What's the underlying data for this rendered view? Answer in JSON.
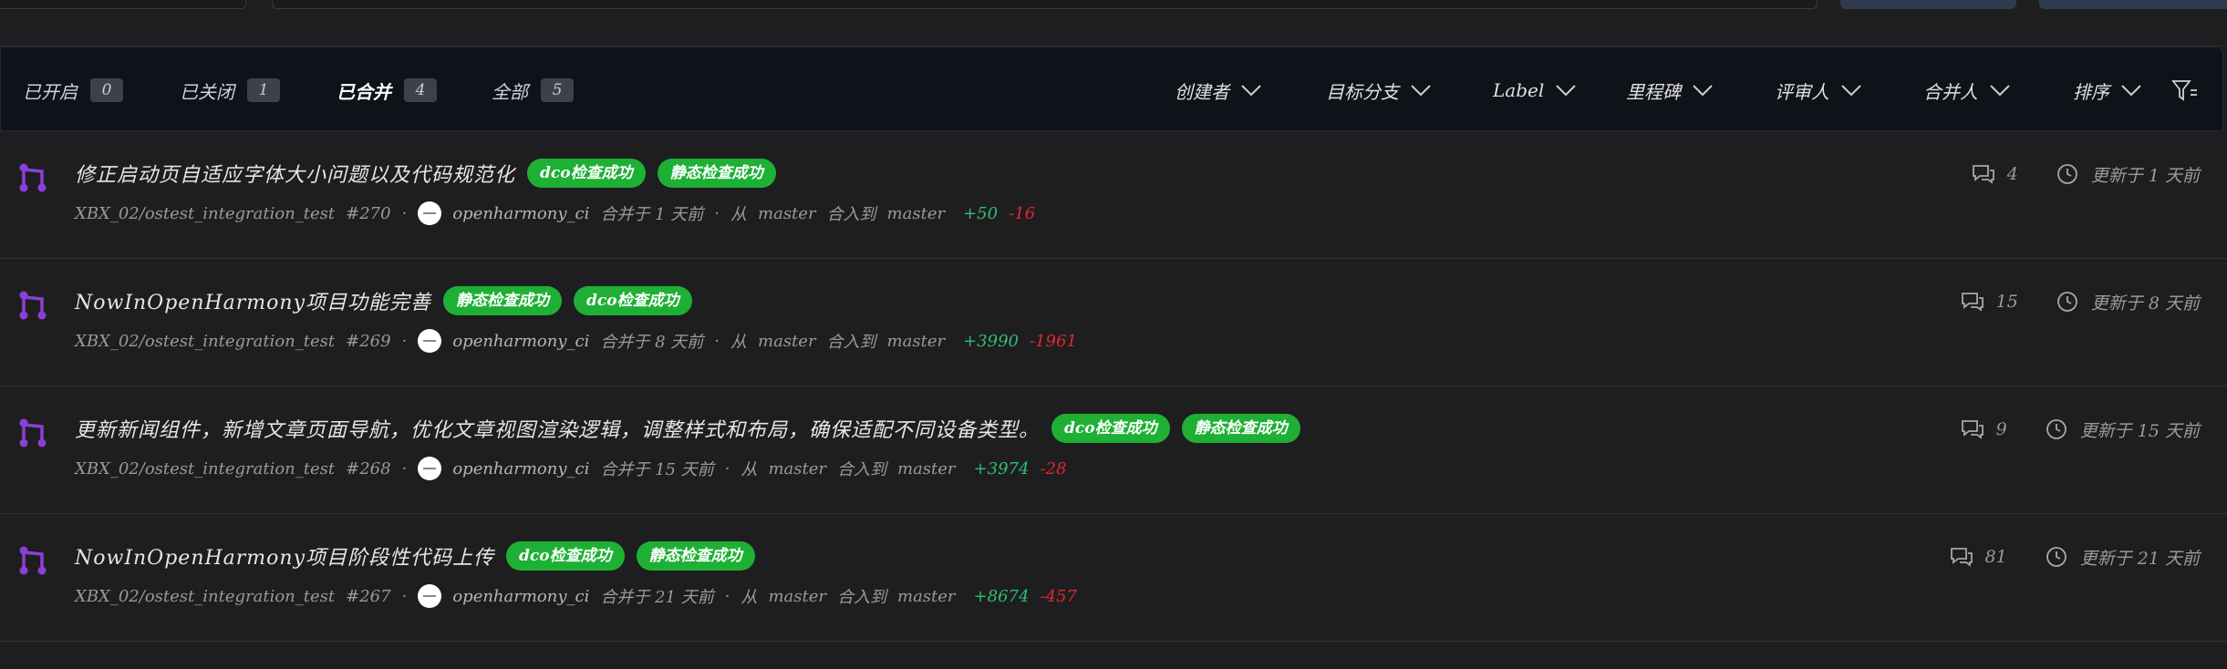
{
  "state_tabs": [
    {
      "label": "已开启",
      "count": "0"
    },
    {
      "label": "已关闭",
      "count": "1"
    },
    {
      "label": "已合并",
      "count": "4"
    },
    {
      "label": "全部",
      "count": "5"
    }
  ],
  "filters": [
    "创建者",
    "目标分支",
    "Label",
    "里程碑",
    "评审人",
    "合并人",
    "排序"
  ],
  "prs": [
    {
      "title": "修正启动页自适应字体大小问题以及代码规范化",
      "badges": [
        "dco检查成功",
        "静态检查成功"
      ],
      "repo": "XBX_02/ostest_integration_test",
      "number": "#270",
      "user": "openharmony_ci",
      "merged": "合并于 1 天前",
      "from_label": "从",
      "from": "master",
      "into_label": "合入到",
      "into": "master",
      "additions": "+50",
      "deletions": "-16",
      "comments": "4",
      "updated": "更新于 1 天前"
    },
    {
      "title": "NowInOpenHarmony项目功能完善",
      "badges": [
        "静态检查成功",
        "dco检查成功"
      ],
      "repo": "XBX_02/ostest_integration_test",
      "number": "#269",
      "user": "openharmony_ci",
      "merged": "合并于 8 天前",
      "from_label": "从",
      "from": "master",
      "into_label": "合入到",
      "into": "master",
      "additions": "+3990",
      "deletions": "-1961",
      "comments": "15",
      "updated": "更新于 8 天前"
    },
    {
      "title": "更新新闻组件，新增文章页面导航，优化文章视图渲染逻辑，调整样式和布局，确保适配不同设备类型。",
      "badges": [
        "dco检查成功",
        "静态检查成功"
      ],
      "repo": "XBX_02/ostest_integration_test",
      "number": "#268",
      "user": "openharmony_ci",
      "merged": "合并于 15 天前",
      "from_label": "从",
      "from": "master",
      "into_label": "合入到",
      "into": "master",
      "additions": "+3974",
      "deletions": "-28",
      "comments": "9",
      "updated": "更新于 15 天前"
    },
    {
      "title": "NowInOpenHarmony项目阶段性代码上传",
      "badges": [
        "dco检查成功",
        "静态检查成功"
      ],
      "repo": "XBX_02/ostest_integration_test",
      "number": "#267",
      "user": "openharmony_ci",
      "merged": "合并于 21 天前",
      "from_label": "从",
      "from": "master",
      "into_label": "合入到",
      "into": "master",
      "additions": "+8674",
      "deletions": "-457",
      "comments": "81",
      "updated": "更新于 21 天前"
    }
  ],
  "separator": "·",
  "colors": {
    "badge_bg": "#1eb035",
    "additions": "#2fbf71",
    "deletions": "#e0282e",
    "pr_icon": "#8b3fd9",
    "filterbar_bg": "#0f1219"
  }
}
